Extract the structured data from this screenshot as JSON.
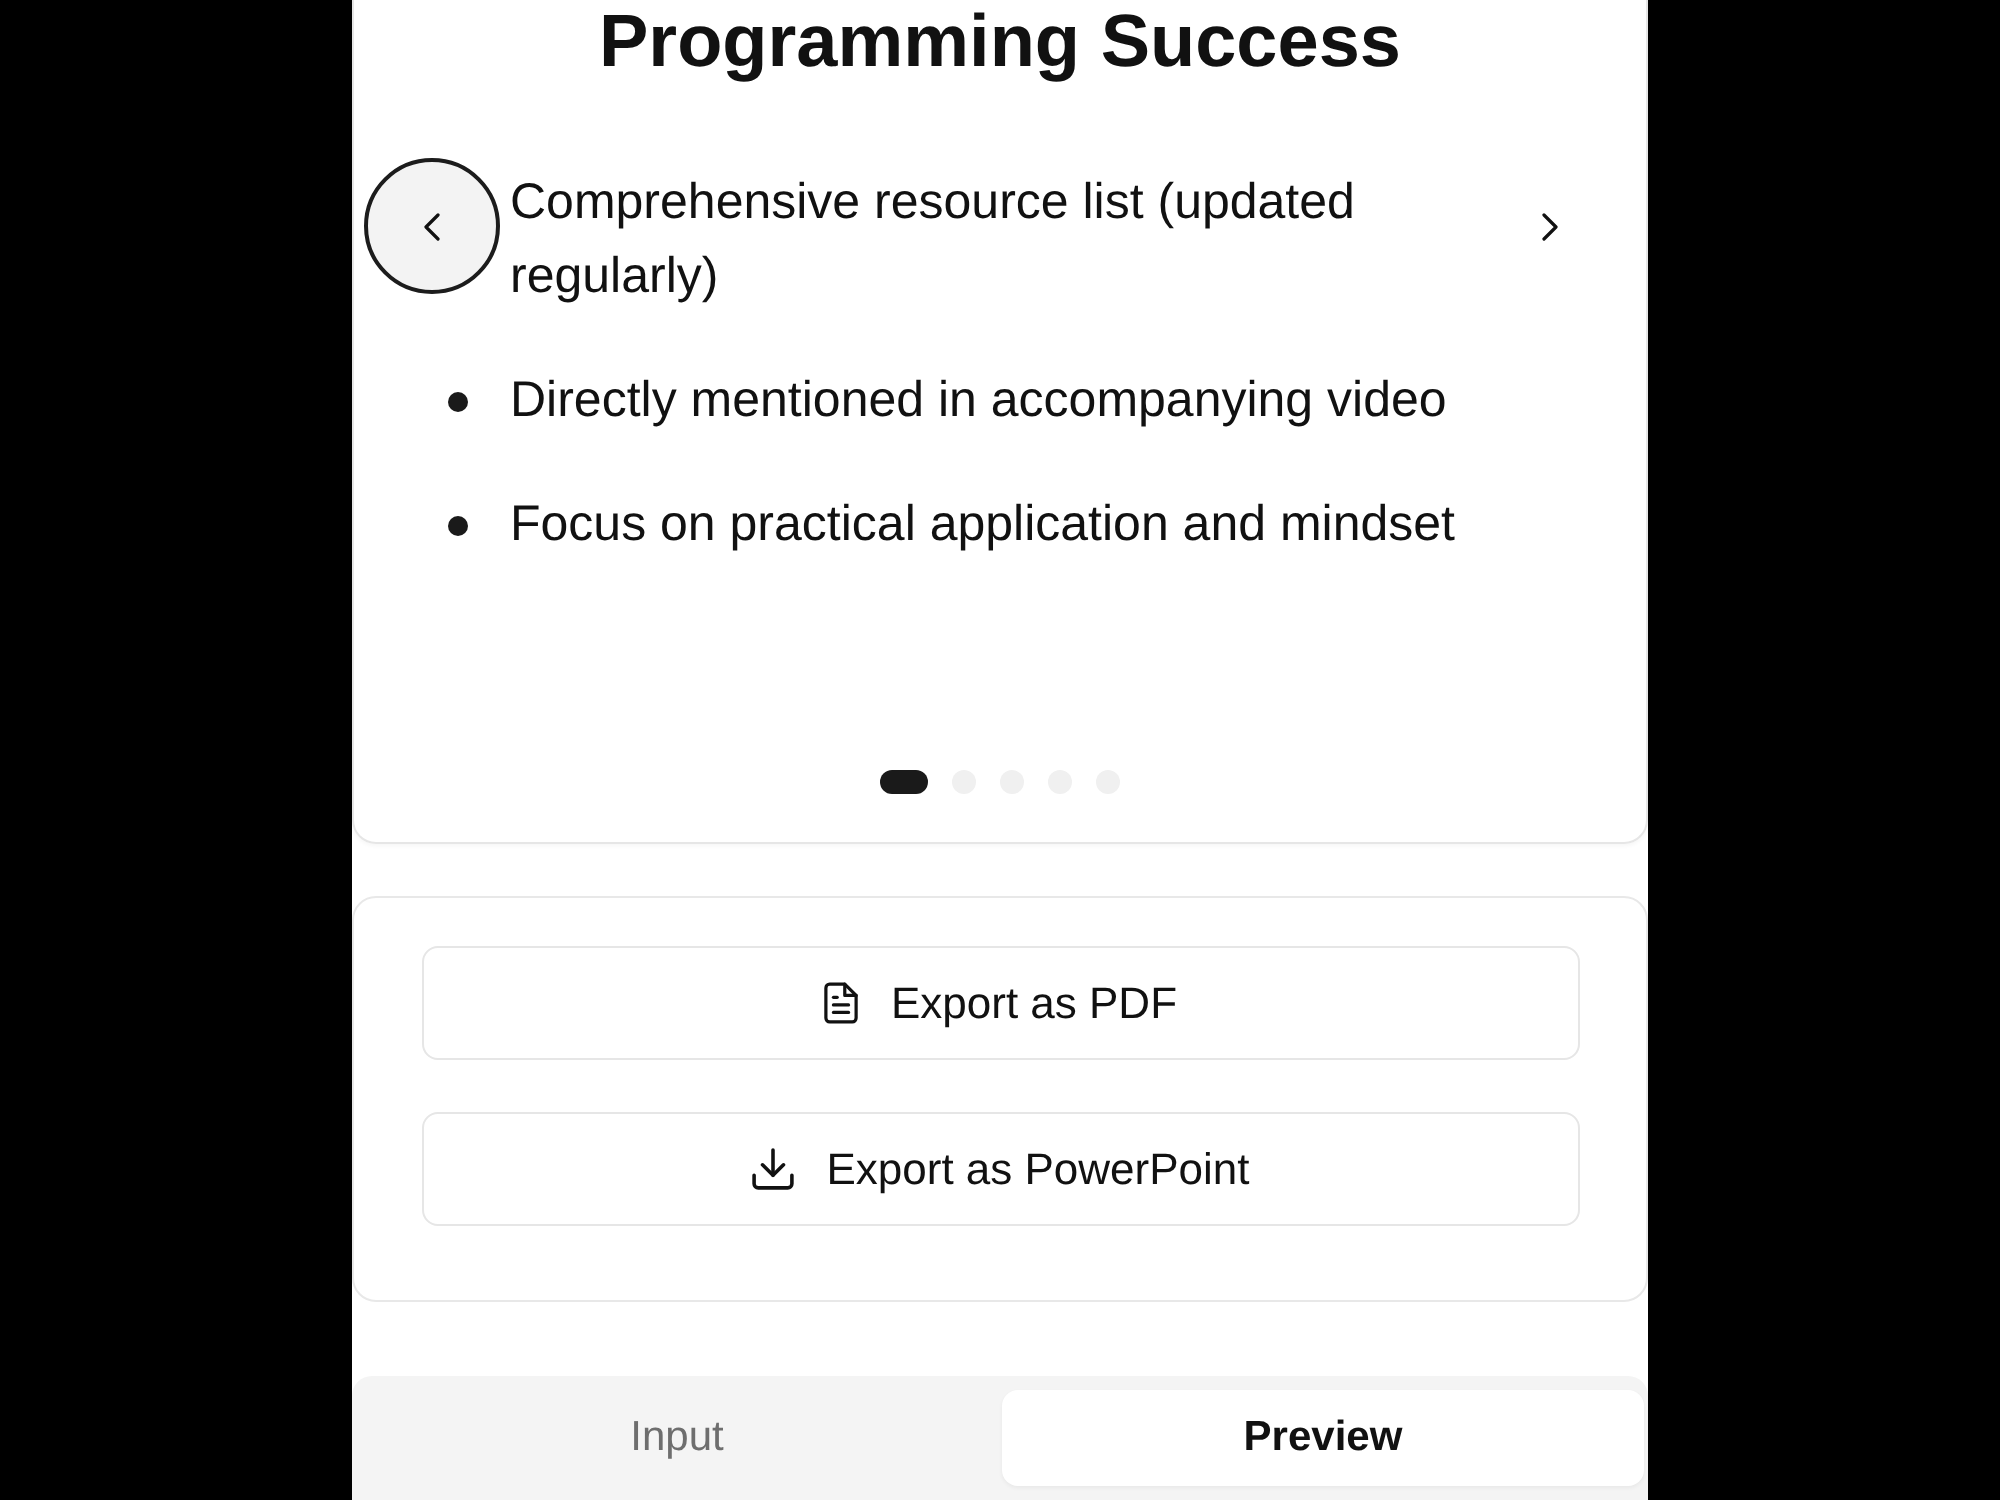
{
  "slide": {
    "title": "Programming Success",
    "previous_button": {
      "focused": true
    },
    "next_button": {
      "focused": false
    },
    "items": [
      {
        "text": "Comprehensive resource list (updated regularly)",
        "marker": false
      },
      {
        "text": "Directly mentioned in accompanying video",
        "marker": true
      },
      {
        "text": "Focus on practical application and mindset",
        "marker": true
      }
    ],
    "dots": [
      {
        "selected": true
      },
      {
        "selected": false
      },
      {
        "selected": false
      },
      {
        "selected": false
      },
      {
        "selected": false
      }
    ]
  },
  "export": {
    "buttons": [
      {
        "kind": "document",
        "label": "Export as PDF"
      },
      {
        "kind": "download",
        "label": "Export as PowerPoint"
      }
    ]
  },
  "tabs": [
    {
      "label": "Input",
      "selected": false
    },
    {
      "label": "Preview",
      "selected": true
    }
  ]
}
